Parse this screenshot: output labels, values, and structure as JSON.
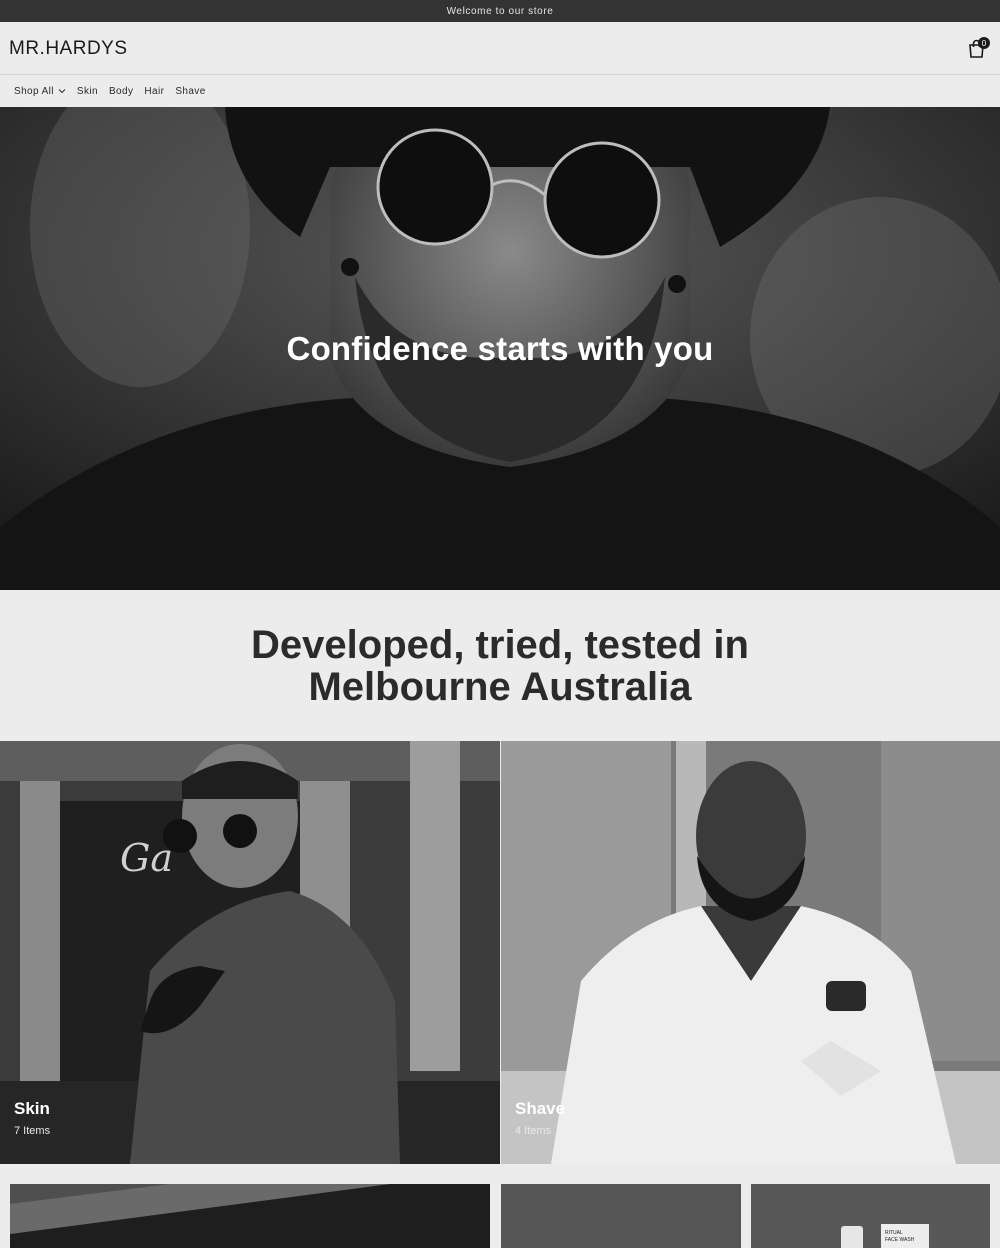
{
  "announcement": "Welcome to our store",
  "header": {
    "logo": "MR.HARDYS",
    "cart_count": "0"
  },
  "nav": {
    "items": [
      {
        "label": "Shop All",
        "has_dropdown": true
      },
      {
        "label": "Skin"
      },
      {
        "label": "Body"
      },
      {
        "label": "Hair"
      },
      {
        "label": "Shave"
      }
    ]
  },
  "hero": {
    "title": "Confidence starts with you"
  },
  "tagline": {
    "text": "Developed, tried, tested in Melbourne Australia"
  },
  "collections": [
    {
      "title": "Skin",
      "count": "7 Items"
    },
    {
      "title": "Shave",
      "count": "4 Items"
    }
  ],
  "product_teaser": {
    "label_lines": [
      "RITUAL",
      "FACE WASH"
    ]
  },
  "colors": {
    "announcement_bg": "#333333",
    "page_bg": "#ececec",
    "text": "#1b1b1b"
  }
}
